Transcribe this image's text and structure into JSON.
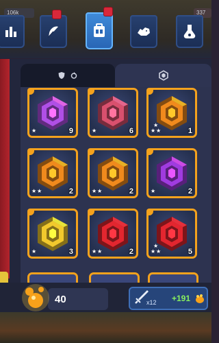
{
  "hud": {
    "left_text": "106k",
    "right_text": "337"
  },
  "top_tabs": [
    {
      "name": "stats",
      "icon": "bar-chart-icon",
      "active": false,
      "badge": false
    },
    {
      "name": "skills",
      "icon": "feather-icon",
      "active": false,
      "badge": true
    },
    {
      "name": "inventory",
      "icon": "backpack-icon",
      "active": true,
      "badge": true
    },
    {
      "name": "pets",
      "icon": "rhino-icon",
      "active": false,
      "badge": false
    },
    {
      "name": "potions",
      "icon": "potion-flask-icon",
      "active": false,
      "badge": false
    }
  ],
  "sub_tabs": [
    {
      "name": "equipped",
      "icons": [
        "shield-icon",
        "refresh-icon"
      ],
      "active": true
    },
    {
      "name": "all-gems",
      "icons": [
        "hex-gem-icon"
      ],
      "active": false
    }
  ],
  "gems": [
    {
      "color": "#b04fe6",
      "count": "9",
      "stars": 1
    },
    {
      "color": "#d9506e",
      "count": "6",
      "stars": 1
    },
    {
      "color": "#f08a1d",
      "count": "1",
      "stars": 3
    },
    {
      "color": "#f08a1d",
      "count": "2",
      "stars": 2
    },
    {
      "color": "#f08a1d",
      "count": "2",
      "stars": 2
    },
    {
      "color": "#a03be0",
      "count": "2",
      "stars": 1
    },
    {
      "color": "#f2c92d",
      "count": "3",
      "stars": 1
    },
    {
      "color": "#e3262f",
      "count": "2",
      "stars": 2
    },
    {
      "color": "#e3262f",
      "count": "5",
      "stars": 3
    }
  ],
  "footer": {
    "coins": "40",
    "sword_multiplier": "x12",
    "reward": "+191"
  }
}
